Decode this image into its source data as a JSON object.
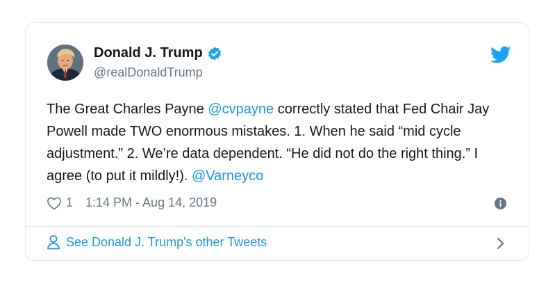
{
  "author": {
    "display_name": "Donald J. Trump",
    "handle": "@realDonaldTrump",
    "avatar_icon": "profile-photo",
    "verified_icon": "verified-badge-icon"
  },
  "tweet": {
    "text_before_mention1": "The Great Charles Payne ",
    "mention1": "@cvpayne",
    "text_after_mention1": " correctly stated that Fed Chair Jay Powell made TWO enormous mistakes. 1. When he said “mid cycle adjustment.” 2. We’re data dependent.  “He did not do the right thing.” I agree (to put it mildly!). ",
    "mention2": "@Varneyco"
  },
  "meta": {
    "like_count": "1",
    "timestamp": "1:14 PM - Aug 14, 2019"
  },
  "footer": {
    "see_more_label": "See Donald J. Trump's other Tweets"
  },
  "colors": {
    "link": "#1b95e0",
    "muted": "#657786",
    "border": "#e1e8ed",
    "text": "#14171a"
  }
}
